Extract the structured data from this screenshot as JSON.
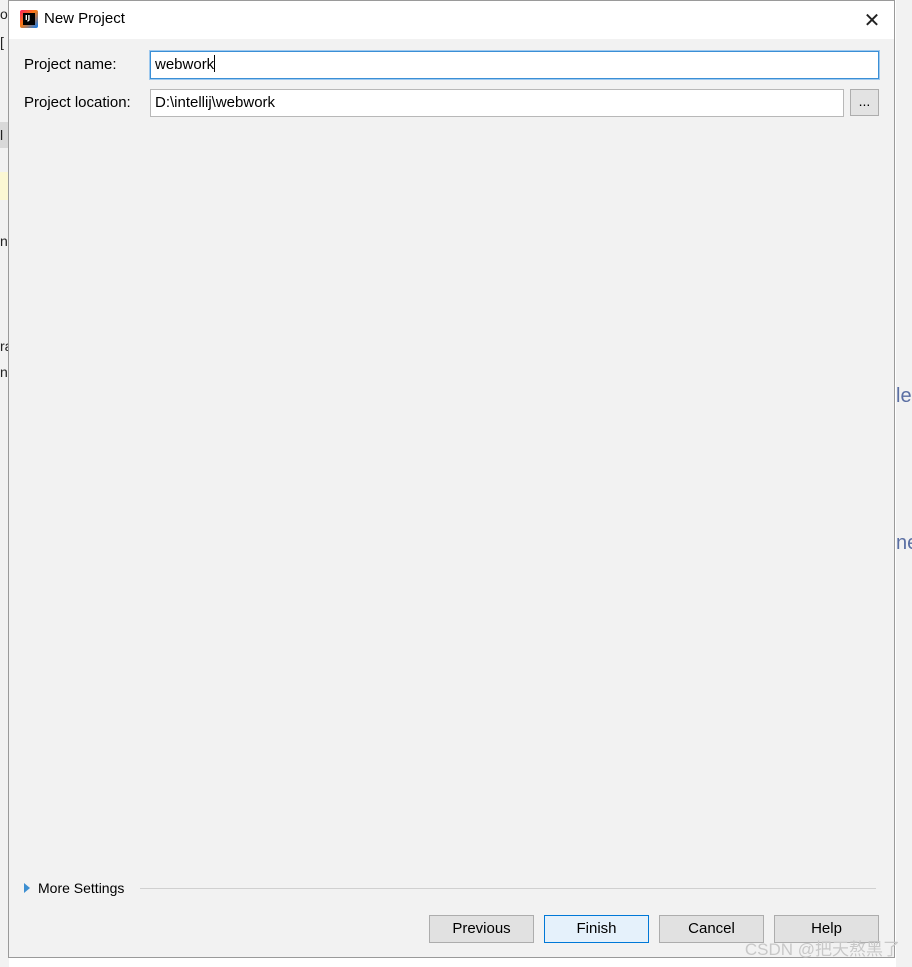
{
  "dialog": {
    "title": "New Project",
    "close_label": "✕"
  },
  "form": {
    "project_name_label": "Project name:",
    "project_name_value": "webwork",
    "project_location_label": "Project location:",
    "project_location_value": "D:\\intellij\\webwork",
    "browse_label": "..."
  },
  "more_settings": {
    "label": "More Settings"
  },
  "buttons": {
    "previous": "Previous",
    "finish": "Finish",
    "cancel": "Cancel",
    "help": "Help"
  },
  "background": {
    "left_fragments": [
      "o",
      "[",
      "l",
      "nl",
      "ra",
      "nc"
    ],
    "right_fragments": [
      "le",
      "ne"
    ]
  },
  "watermark": "CSDN @把天熬黑了",
  "colors": {
    "accent": "#0078d7",
    "focus_border": "#3a8fd6",
    "dialog_bg": "#f2f2f2"
  },
  "icons": {
    "app": "intellij-idea-icon",
    "expand": "triangle-right-icon"
  }
}
